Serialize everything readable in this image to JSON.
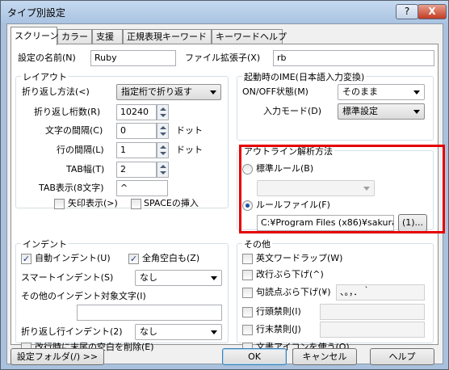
{
  "window": {
    "title": "タイプ別設定",
    "help_label": "?",
    "close_label": "X"
  },
  "tabs": [
    "スクリーン",
    "カラー",
    "支援",
    "正規表現キーワード",
    "キーワードヘルプ"
  ],
  "top": {
    "name_label": "設定の名前(N)",
    "name_value": "Ruby",
    "ext_label": "ファイル拡張子(X)",
    "ext_value": "rb"
  },
  "layout": {
    "title": "レイアウト",
    "wrap_method_label": "折り返し方法(<)",
    "wrap_method_value": "指定桁で折り返す",
    "wrap_digits_label": "折り返し桁数(R)",
    "wrap_digits_value": "10240",
    "char_spacing_label": "文字の間隔(C)",
    "char_spacing_value": "0",
    "char_spacing_unit": "ドット",
    "line_spacing_label": "行の間隔(L)",
    "line_spacing_value": "1",
    "line_spacing_unit": "ドット",
    "tab_width_label": "TAB幅(T)",
    "tab_width_value": "2",
    "tab_display_label": "TAB表示(8文字)",
    "tab_display_value": "^",
    "arrow_display_label": "矢印表示(>)",
    "space_insert_label": "SPACEの挿入"
  },
  "ime": {
    "title": "起動時のIME(日本語入力変換)",
    "onoff_label": "ON/OFF状態(M)",
    "onoff_value": "そのまま",
    "input_mode_label": "入力モード(D)",
    "input_mode_value": "標準設定"
  },
  "outline": {
    "title": "アウトライン解析方法",
    "standard_rule_label": "標準ルール(B)",
    "rule_file_label": "ルールファイル(F)",
    "rule_file_value": "C:¥Program Files (x86)¥sakura",
    "browse_label": "(1)..."
  },
  "indent": {
    "title": "インデント",
    "auto_indent_label": "自動インデント(U)",
    "fullwidth_space_label": "全角空白も(Z)",
    "smart_indent_label": "スマートインデント(S)",
    "smart_indent_value": "なし",
    "other_chars_label": "その他のインデント対象文字(I)",
    "wrap_indent_label": "折り返し行インデント(2)",
    "wrap_indent_value": "なし",
    "trim_trailing_label": "改行時に末尾の空白を削除(E)"
  },
  "other": {
    "title": "その他",
    "word_wrap_label": "英文ワードラップ(W)",
    "hang_newline_label": "改行ぶら下げ(^)",
    "hang_punct_label": "句読点ぶら下げ(¥)",
    "hang_punct_value": "、。，．｀",
    "kinsoku_head_label": "行頭禁則(I)",
    "kinsoku_tail_label": "行末禁則(J)",
    "doc_icon_label": "文書アイコンを使う(O)"
  },
  "footer": {
    "folder_label": "設定フォルダ(/) >>",
    "ok_label": "OK",
    "cancel_label": "キャンセル",
    "help_label": "ヘルプ"
  }
}
